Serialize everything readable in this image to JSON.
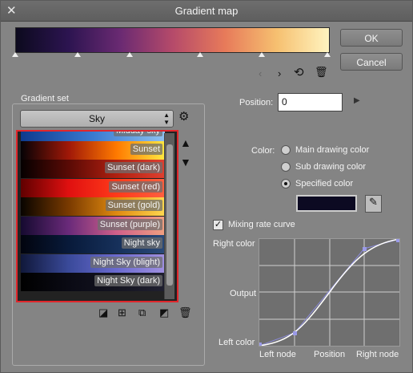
{
  "window": {
    "title": "Gradient map",
    "close_icon": "close-icon"
  },
  "gradient_bar": {
    "colors": [
      "#0c0a1e",
      "#2c1450",
      "#6a2a72",
      "#b54a6a",
      "#e77a5a",
      "#f6c070",
      "#fff4c0"
    ]
  },
  "buttons": {
    "ok": "OK",
    "cancel": "Cancel"
  },
  "gradient_set": {
    "label": "Gradient set",
    "selected": "Sky",
    "items": [
      {
        "label": "Midday sky",
        "colors": [
          "#0e3a8e",
          "#3a7ad0",
          "#8ec0f0"
        ]
      },
      {
        "label": "Sunset",
        "colors": [
          "#050205",
          "#a01808",
          "#ff7a00",
          "#ffe840"
        ]
      },
      {
        "label": "Sunset (dark)",
        "colors": [
          "#050000",
          "#5a0a05",
          "#b02010",
          "#e04030"
        ]
      },
      {
        "label": "Sunset (red)",
        "colors": [
          "#600000",
          "#e01010",
          "#ff3a1a",
          "#ff6040"
        ]
      },
      {
        "label": "Sunset (gold)",
        "colors": [
          "#080400",
          "#7a3a00",
          "#e08a10",
          "#ffd850"
        ]
      },
      {
        "label": "Sunset (purple)",
        "colors": [
          "#150a30",
          "#6a2a7a",
          "#d0608a",
          "#f0a080"
        ]
      },
      {
        "label": "Night sky",
        "colors": [
          "#02040e",
          "#081a3a",
          "#16305a",
          "#2a4a7a"
        ]
      },
      {
        "label": "Night Sky (blight)",
        "colors": [
          "#10183a",
          "#3a4a9a",
          "#6a6ad0",
          "#a090e0"
        ]
      },
      {
        "label": "Night Sky (dark)",
        "colors": [
          "#000000",
          "#0a0a14",
          "#141420",
          "#202030"
        ]
      }
    ]
  },
  "position": {
    "label": "Position:",
    "value": "0"
  },
  "color": {
    "label": "Color:",
    "options": [
      "Main drawing color",
      "Sub drawing color",
      "Specified color"
    ],
    "selected_index": 2,
    "specified_swatch": "#0c0a22"
  },
  "mixing": {
    "label": "Mixing rate curve",
    "checked": true
  },
  "curve": {
    "right_color": "Right color",
    "output": "Output",
    "left_color": "Left color",
    "left_node": "Left node",
    "position": "Position",
    "right_node": "Right node"
  }
}
